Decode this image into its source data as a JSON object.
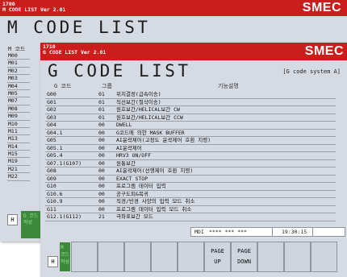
{
  "m_window": {
    "header_line1": "1700",
    "header_line2": "M CODE LIST Ver 2.01",
    "brand": "SMEC",
    "title": "M CODE LIST",
    "list_header": "M 코드",
    "items": [
      "M00",
      "M01",
      "M02",
      "M03",
      "M04",
      "M05",
      "M07",
      "M08",
      "M09",
      "M10",
      "M11",
      "M13",
      "M14",
      "M15",
      "M19",
      "M21",
      "M22"
    ],
    "h_button": "H",
    "green_panel_label": "G 코드\n작성"
  },
  "g_window": {
    "header_line1": "1710",
    "header_line2": "G CODE LIST Ver 2.01",
    "brand": "SMEC",
    "title": "G CODE LIST",
    "system_label": "[G code system A]",
    "columns": {
      "code": "G 코드",
      "group": "그룹",
      "description": "기능설명"
    },
    "rows": [
      {
        "code": "G00",
        "group": "01",
        "desc": "위치결정(급속이송)"
      },
      {
        "code": "G01",
        "group": "01",
        "desc": "직선보간(절삭이송)"
      },
      {
        "code": "G02",
        "group": "01",
        "desc": "원호보간/HELICAL보간 CW"
      },
      {
        "code": "G03",
        "group": "01",
        "desc": "원호보간/HELICAL보간 CCW"
      },
      {
        "code": "G04",
        "group": "00",
        "desc": "DWELL"
      },
      {
        "code": "G04.1",
        "group": "00",
        "desc": "G코드에 의한 MASK BUFFER"
      },
      {
        "code": "G05",
        "group": "00",
        "desc": "AI윤곽제어(고정도 윤곽제어 호환 지령)"
      },
      {
        "code": "G05.1",
        "group": "00",
        "desc": "AI윤곽제어"
      },
      {
        "code": "G05.4",
        "group": "00",
        "desc": "HRV3 ON/OFF"
      },
      {
        "code": "G07.1(G107)",
        "group": "00",
        "desc": "원통보간"
      },
      {
        "code": "G08",
        "group": "00",
        "desc": "AI윤곽제어(선행제어 호환 지령)"
      },
      {
        "code": "G09",
        "group": "00",
        "desc": "EXACT STOP"
      },
      {
        "code": "G10",
        "group": "00",
        "desc": "프로그램 데이터 입력"
      },
      {
        "code": "G10.6",
        "group": "00",
        "desc": "공구도피&복귀"
      },
      {
        "code": "G10.9",
        "group": "00",
        "desc": "직경/반경 사양의 입력 모드 취소"
      },
      {
        "code": "G11",
        "group": "00",
        "desc": "프로그램 데이터 입력 모드 취소"
      },
      {
        "code": "G12.1(G112)",
        "group": "21",
        "desc": "극좌표보간 모드"
      }
    ],
    "status": {
      "mode": "MDI",
      "stars": "**** *** ***",
      "time": "19:30:15"
    },
    "softkeys": [
      {
        "line1": "",
        "line2": ""
      },
      {
        "line1": "",
        "line2": ""
      },
      {
        "line1": "",
        "line2": ""
      },
      {
        "line1": "",
        "line2": ""
      },
      {
        "line1": "",
        "line2": ""
      },
      {
        "line1": "PAGE",
        "line2": "UP"
      },
      {
        "line1": "PAGE",
        "line2": "DOWN"
      },
      {
        "line1": "",
        "line2": ""
      },
      {
        "line1": "",
        "line2": ""
      },
      {
        "line1": "",
        "line2": ""
      }
    ],
    "h_button": "H",
    "green_panel_label": "M 코드\n작성"
  }
}
